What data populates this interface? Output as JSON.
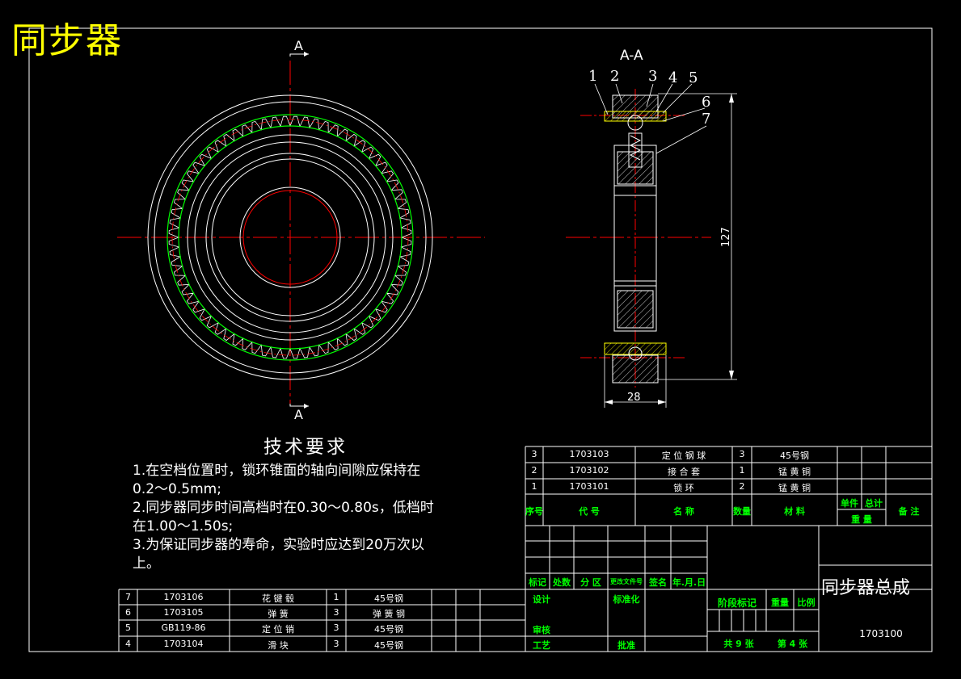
{
  "title": "同步器",
  "section_label": "A-A",
  "section_markers": {
    "top": "A",
    "bottom": "A"
  },
  "balloons": [
    "1",
    "2",
    "3",
    "4",
    "5",
    "6",
    "7"
  ],
  "dimensions": {
    "height": "127",
    "width": "28"
  },
  "tech_requirements": {
    "title": "技术要求",
    "lines": [
      "1.在空档位置时，锁环锥面的轴向间隙应保持在",
      "0.2～0.5mm;",
      "2.同步器同步时间高档时在0.30～0.80s，低档时",
      "在1.00～1.50s;",
      "3.为保证同步器的寿命，实验时应达到20万次以",
      "上。"
    ]
  },
  "bom_upper": [
    {
      "no": "3",
      "code": "1703103",
      "name": "定 位 钢 球",
      "qty": "3",
      "material": "45号钢"
    },
    {
      "no": "2",
      "code": "1703102",
      "name": "接 合 套",
      "qty": "1",
      "material": "锰 黄 铜"
    },
    {
      "no": "1",
      "code": "1703101",
      "name": "锁 环",
      "qty": "2",
      "material": "锰 黄 铜"
    }
  ],
  "bom_lower": [
    {
      "no": "7",
      "code": "1703106",
      "name": "花 键 毂",
      "qty": "1",
      "material": "45号钢"
    },
    {
      "no": "6",
      "code": "1703105",
      "name": "弹 簧",
      "qty": "3",
      "material": "弹 簧 钢"
    },
    {
      "no": "5",
      "code": "GB119-86",
      "name": "定 位 销",
      "qty": "3",
      "material": "45号钢"
    },
    {
      "no": "4",
      "code": "1703104",
      "name": "滑 块",
      "qty": "3",
      "material": "45号钢"
    }
  ],
  "bom_header": {
    "no": "序号",
    "code": "代 号",
    "name": "名 称",
    "qty": "数量",
    "material": "材 料",
    "unit": "单件",
    "total": "总计",
    "weight": "重 量",
    "remark": "备 注"
  },
  "title_block": {
    "revision_row": [
      "标记",
      "处数",
      "分 区",
      "更改文件号",
      "签名",
      "年.月.日"
    ],
    "design": "设计",
    "standardize": "标准化",
    "check": "审核",
    "process": "工艺",
    "approve": "批准",
    "stage": "阶段标记",
    "weight": "重量",
    "scale": "比例",
    "sheets": "共 9 张",
    "sheet_no": "第 4 张",
    "drawing_name": "同步器总成",
    "drawing_code": "1703100"
  },
  "colors": {
    "line": "#ffffff",
    "center": "#ff0000",
    "gear": "#00ff00",
    "accent": "#ffff00",
    "text_green": "#00ff00"
  }
}
